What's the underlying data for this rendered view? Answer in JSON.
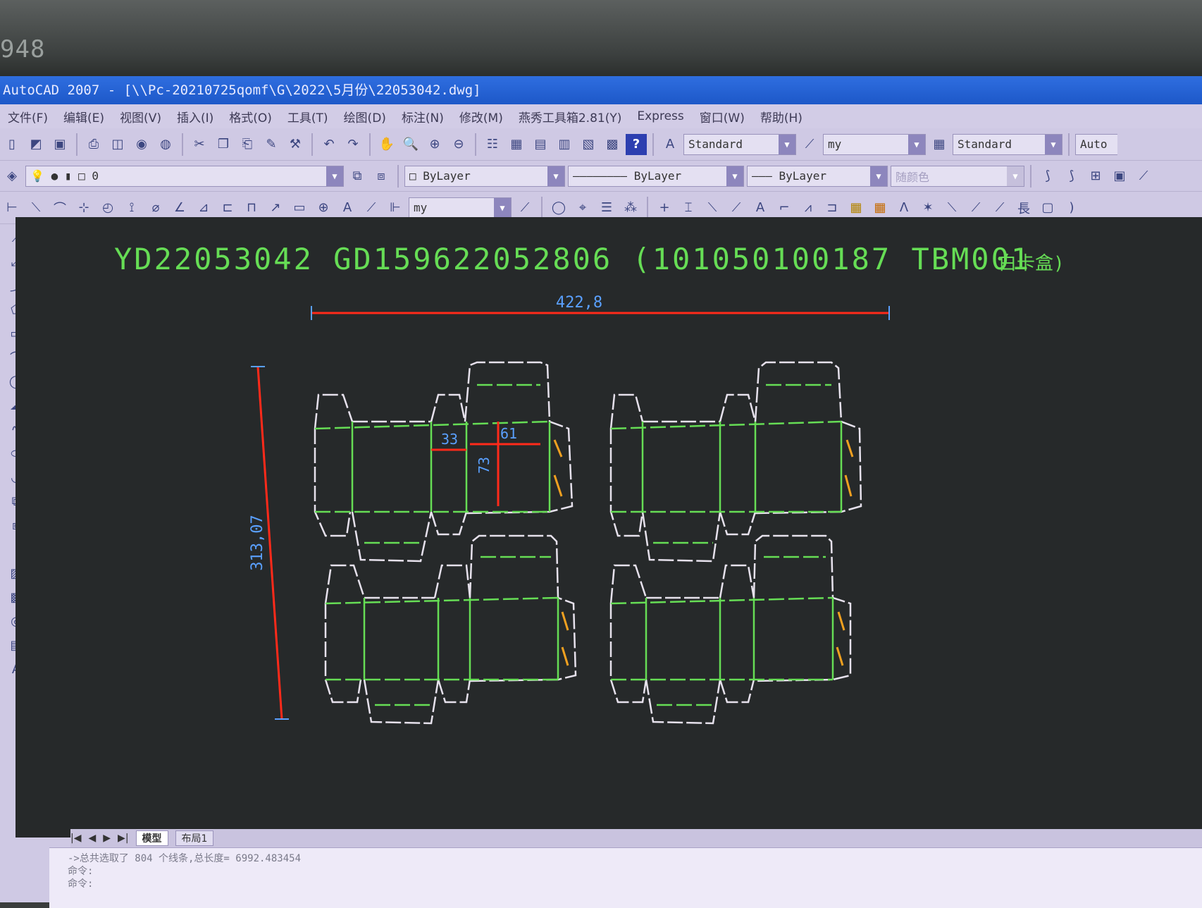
{
  "bezel": {
    "number": "948"
  },
  "window": {
    "title": "AutoCAD 2007 - [\\\\Pc-20210725qomf\\G\\2022\\5月份\\22053042.dwg]"
  },
  "menu": [
    "文件(F)",
    "编辑(E)",
    "视图(V)",
    "插入(I)",
    "格式(O)",
    "工具(T)",
    "绘图(D)",
    "标注(N)",
    "修改(M)",
    "燕秀工具箱2.81(Y)",
    "Express",
    "窗口(W)",
    "帮助(H)"
  ],
  "toolbar": {
    "text_style": "Standard",
    "dim_style": "my",
    "table_style": "Standard",
    "auto_label": "Auto",
    "layer": "0",
    "color": "ByLayer",
    "linetype": "ByLayer",
    "lineweight": "ByLayer",
    "plot_style": "随颜色",
    "dim_style_2": "my"
  },
  "drawing": {
    "header_text": "YD22053042 GD159622052806 (101050100187 TBM001",
    "header_cn": "白卡盒)",
    "dim_width": "422,8",
    "dim_height": "313,07",
    "dim_a": "33",
    "dim_b": "61",
    "dim_c": "73",
    "colors": {
      "cut": "#e6e1ec",
      "crease": "#66dd55",
      "dim": "#ff2a1a",
      "dimtext": "#5aa0ff",
      "glue": "#f0a020"
    }
  },
  "tabs": [
    "模型",
    "布局1"
  ],
  "command": {
    "line1": "->总共选取了 804 个线条,总长度= 6992.483454",
    "line2": "命令:",
    "line3": "命令:"
  }
}
